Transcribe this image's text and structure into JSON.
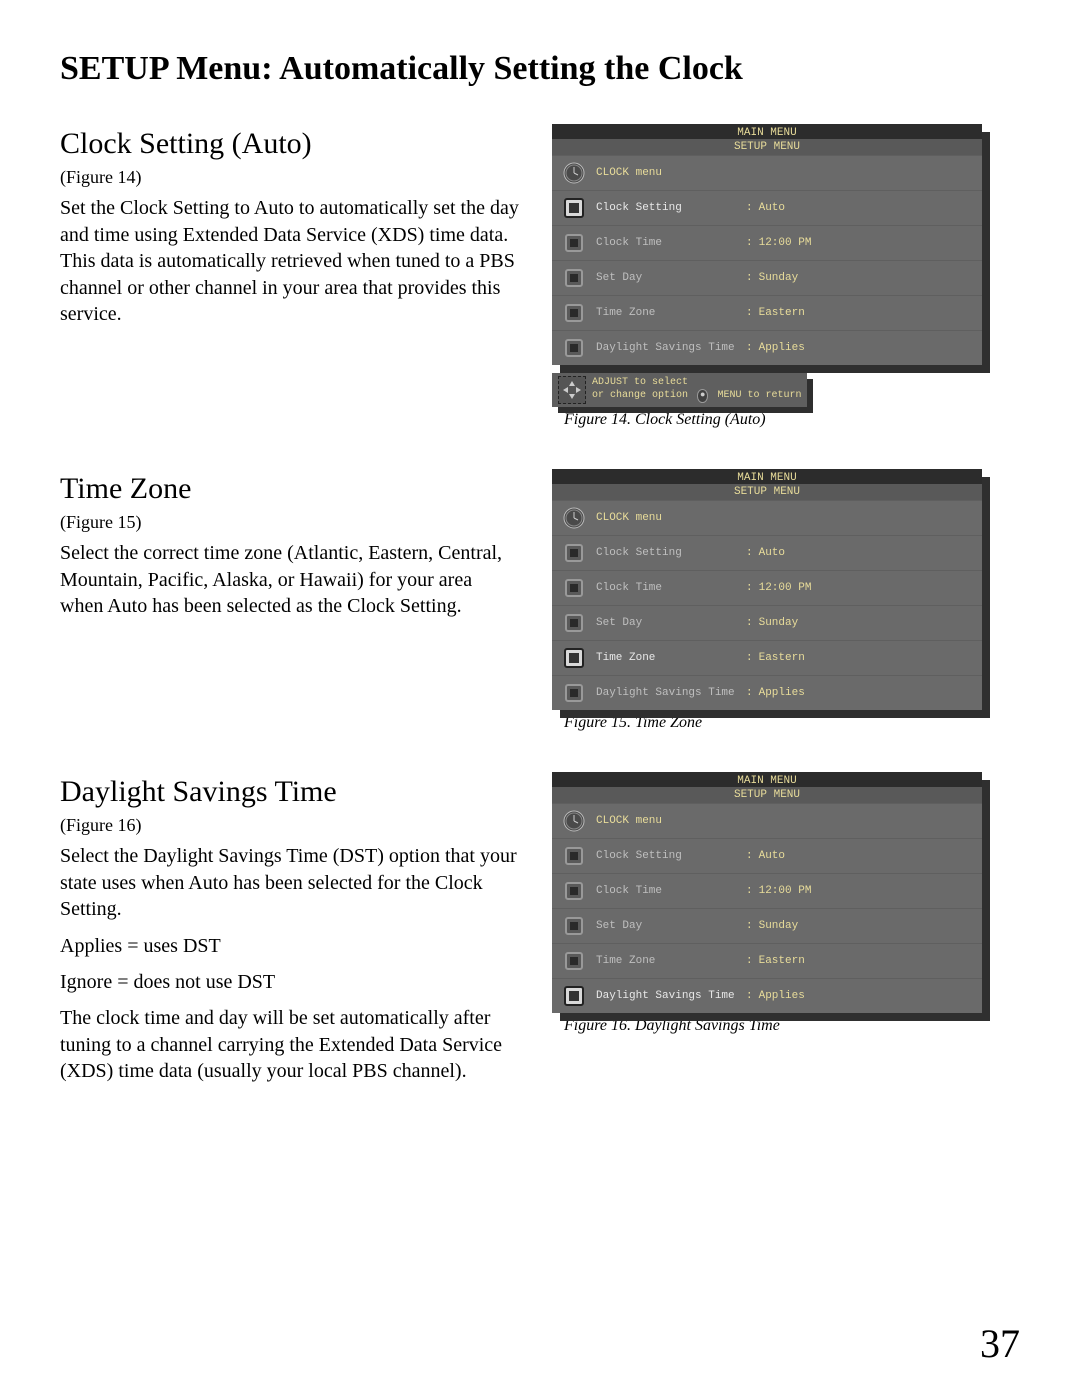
{
  "page_title": "SETUP Menu: Automatically Setting the Clock",
  "page_number": "37",
  "sections": {
    "clock_auto": {
      "heading": "Clock Setting (Auto)",
      "fig_ref": "(Figure 14)",
      "body": "Set the Clock Setting to Auto to automatically set the day and time using Extended Data Service (XDS) time data.  This data is automatically retrieved when tuned to a PBS channel or other channel in your area that provides this service.",
      "caption": "Figure 14.  Clock Setting (Auto)"
    },
    "time_zone": {
      "heading": "Time Zone",
      "fig_ref": "(Figure 15)",
      "body": "Select the correct time zone (Atlantic, Eastern, Central, Mountain, Pacific, Alaska, or Hawaii) for your area when Auto has been selected as the Clock Setting.",
      "caption": "Figure 15.  Time Zone"
    },
    "dst": {
      "heading": "Daylight Savings Time",
      "fig_ref": "(Figure 16)",
      "body1": "Select the Daylight Savings Time (DST) option that your state uses when Auto has been selected for the Clock Setting.",
      "body2": "Applies = uses DST",
      "body3": "Ignore = does not use DST",
      "body4": "The clock time and day will be set automatically after tuning to a channel carrying the Extended Data Service (XDS) time data (usually your local PBS channel).",
      "caption": "Figure 16.  Daylight Savings Time"
    }
  },
  "osd_common": {
    "main_menu": "MAIN MENU",
    "setup_menu": "SETUP MENU",
    "menu_name": "CLOCK menu",
    "rows": {
      "clock_setting": {
        "label": "Clock Setting",
        "value": "Auto"
      },
      "clock_time": {
        "label": "Clock Time",
        "value": "12:00 PM"
      },
      "set_day": {
        "label": "Set Day",
        "value": "Sunday"
      },
      "time_zone": {
        "label": "Time Zone",
        "value": "Eastern"
      },
      "dst": {
        "label": "Daylight Savings Time",
        "value": "Applies"
      }
    },
    "help": {
      "line1": "ADJUST to select",
      "line2a": "or change option",
      "line2b": "MENU to return",
      "menu_pill": "●"
    }
  },
  "figure_highlight": {
    "fig14": "clock_setting",
    "fig15": "time_zone",
    "fig16": "dst"
  }
}
